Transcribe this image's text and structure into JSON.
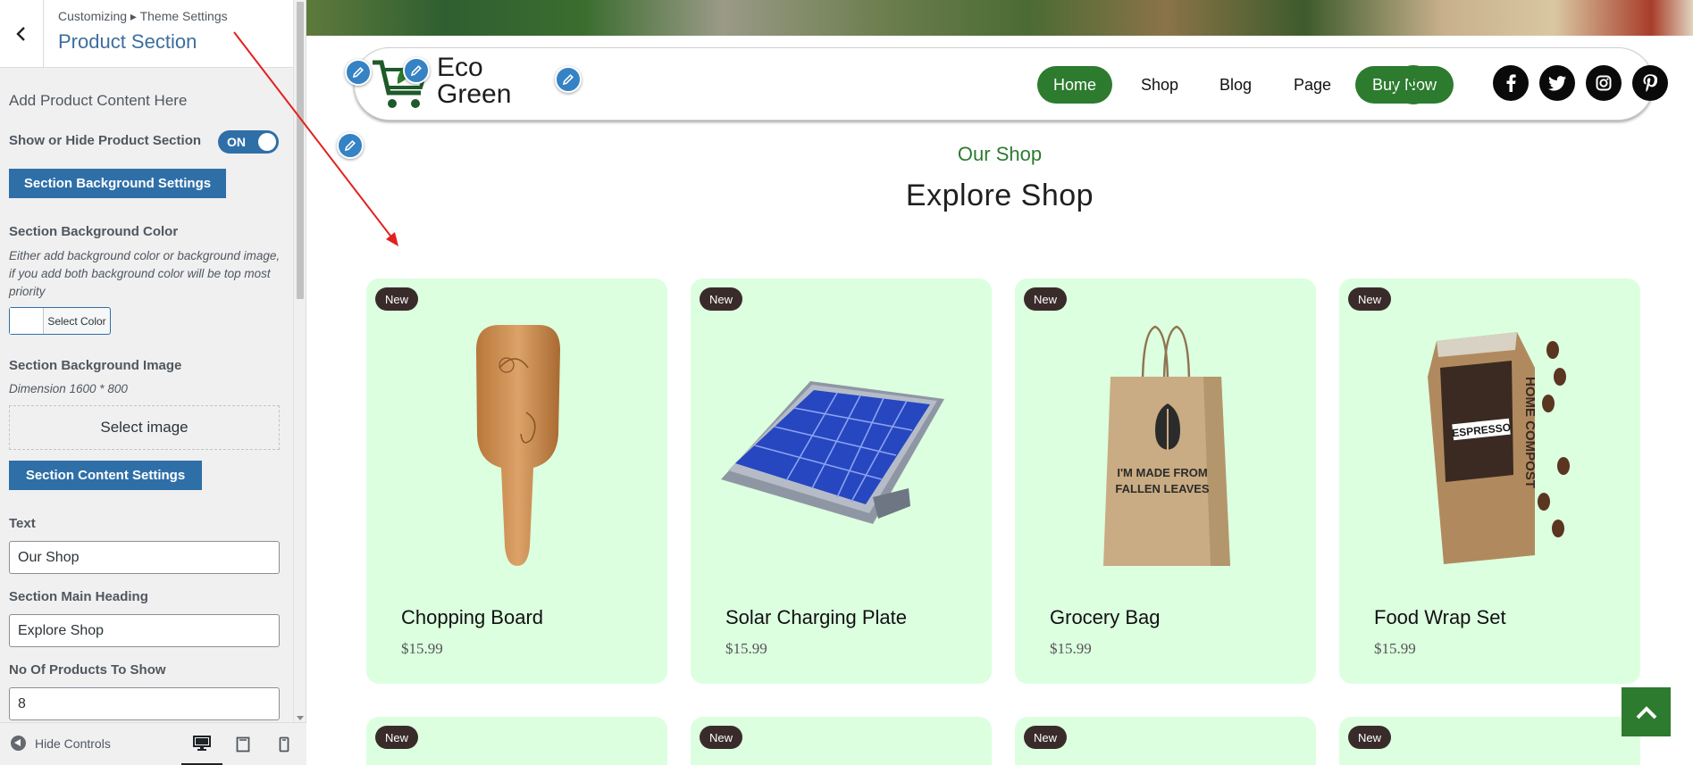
{
  "customizer": {
    "breadcrumb": "Customizing ▸ Theme Settings",
    "section_title": "Product Section",
    "add_content_heading": "Add Product Content Here",
    "show_hide_label": "Show or Hide Product Section",
    "toggle_state": "ON",
    "bg_settings_button": "Section Background Settings",
    "bg_color_label": "Section Background Color",
    "bg_color_note": "Either add background color or background image, if you add both background color will be top most priority",
    "select_color_button": "Select Color",
    "bg_image_label": "Section Background Image",
    "bg_image_dimension": "Dimension 1600 * 800",
    "select_image_button": "Select image",
    "content_settings_button": "Section Content Settings",
    "text_label": "Text",
    "text_value": "Our Shop",
    "main_heading_label": "Section Main Heading",
    "main_heading_value": "Explore Shop",
    "num_products_label": "No Of Products To Show",
    "num_products_value": "8",
    "hide_controls": "Hide Controls",
    "devices": [
      "desktop",
      "tablet",
      "mobile"
    ],
    "accent_color": "#2f6fa8"
  },
  "site": {
    "logo_line1": "Eco",
    "logo_line2": "Green",
    "nav": [
      "Home",
      "Shop",
      "Blog",
      "Page"
    ],
    "nav_active": "Home",
    "cta_button": "Buy Now",
    "social_icons": [
      "facebook-icon",
      "twitter-icon",
      "instagram-icon",
      "pinterest-icon"
    ],
    "brand_color": "#2d7b2e",
    "section_subheading": "Our Shop",
    "section_heading": "Explore Shop",
    "products": [
      {
        "badge": "New",
        "name": "Chopping Board",
        "price": "$15.99",
        "image": "wooden-brush-image"
      },
      {
        "badge": "New",
        "name": "Solar Charging Plate",
        "price": "$15.99",
        "image": "solar-panel-image"
      },
      {
        "badge": "New",
        "name": "Grocery Bag",
        "price": "$15.99",
        "image": "paper-bag-image"
      },
      {
        "badge": "New",
        "name": "Food Wrap Set",
        "price": "$15.99",
        "image": "coffee-bag-image"
      }
    ],
    "products_row2_badges": [
      "New",
      "New",
      "New",
      "New"
    ],
    "bag_print_line1": "I'M MADE FROM",
    "bag_print_line2": "FALLEN LEAVES",
    "coffee_label": "ESPRESSO",
    "coffee_side_text": "HOME COMPOST"
  }
}
